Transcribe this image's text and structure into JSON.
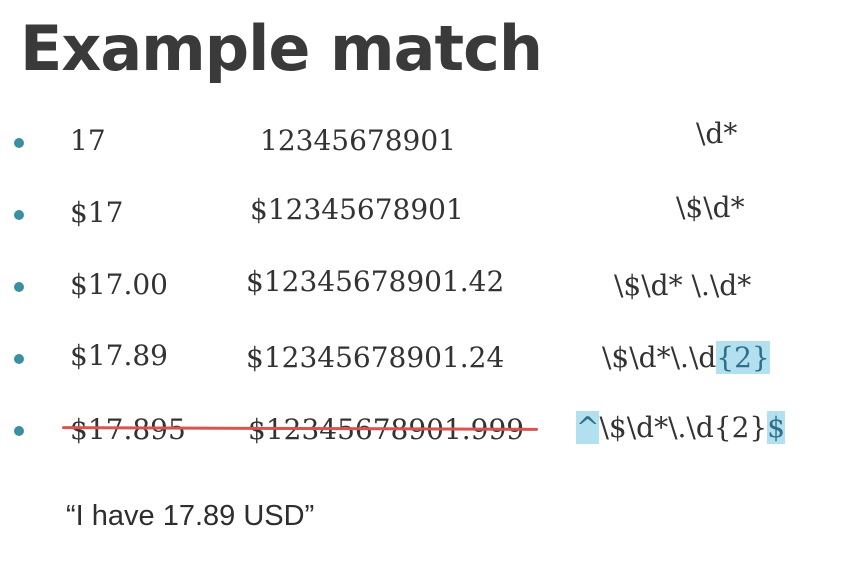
{
  "title": "Example match",
  "rows": [
    {
      "short": "17",
      "long": "12345678901",
      "regex": [
        "\\d*"
      ]
    },
    {
      "short": "$17",
      "long": "$12345678901",
      "regex": [
        "\\$\\d*"
      ]
    },
    {
      "short": "$17.00",
      "long": "$12345678901.42",
      "regex": [
        "\\$\\d* \\.\\d*"
      ]
    },
    {
      "short": "$17.89",
      "long": "$12345678901.24",
      "regex": [
        "\\$\\d*\\.\\d",
        "{2}"
      ]
    },
    {
      "short": "$17.895",
      "long": "$12345678901.999",
      "regex": [
        "^",
        "\\$\\d*\\.\\d{2}",
        "$"
      ]
    }
  ],
  "quote": "“I have 17.89 USD”",
  "colors": {
    "bullet": "#3a8fa5",
    "highlight": "#b3e0ee",
    "strike": "#d9534f"
  }
}
